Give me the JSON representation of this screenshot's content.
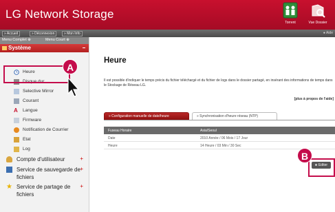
{
  "app_title": "LG Network Storage",
  "header_buttons": [
    {
      "label": "Torrent",
      "icon": "torrent-icon"
    },
    {
      "label": "Vue Dossier",
      "icon": "folder-view-icon"
    }
  ],
  "topbar": {
    "buttons": [
      "» Accueil",
      "» Déconnexion",
      "» Mon Info"
    ],
    "help": "Aide"
  },
  "sidebar": {
    "menu_complet": "Menu Complet ⊕",
    "menu_court": "Menu Court ⊕",
    "system_label": "Système",
    "items": [
      {
        "label": "Heure",
        "icon": "clock-icon"
      },
      {
        "label": "Disque dur",
        "icon": "hard-disk-icon"
      },
      {
        "label": "Selective Mirror",
        "icon": "mirror-icon"
      },
      {
        "label": "Courant",
        "icon": "power-icon"
      },
      {
        "label": "Langue",
        "icon": "language-icon"
      },
      {
        "label": "Firmware",
        "icon": "firmware-icon"
      },
      {
        "label": "Notification de Courrier",
        "icon": "mail-notification-icon"
      },
      {
        "label": "Etat",
        "icon": "status-icon"
      },
      {
        "label": "Log",
        "icon": "log-icon"
      }
    ],
    "groups": [
      {
        "label": "Compte d'utilisateur",
        "icon": "users-icon"
      },
      {
        "label": "Service de sauvegarde de fichiers",
        "icon": "backup-icon"
      },
      {
        "label": "Service de partage de fichiers",
        "icon": "share-icon"
      }
    ]
  },
  "main": {
    "title": "Heure",
    "description": "Il est possible d'indiquer le temps précis du fichier téléchargé et du fichier de logs dans le dossier partagé, en insérant des informations de temps dans le Stockage de Réseau LG.",
    "more_link": "[plus à propos de l'aide]",
    "tabs": [
      "» Configuration manuelle de date/heure",
      "» Synchronisation d'heure réseau (NTP)"
    ],
    "table": {
      "headers": [
        "Fuseau Horaire",
        "Asia/Seoul"
      ],
      "rows": [
        [
          "Date",
          "2010 Année / 06 Mois / 17 Jour"
        ],
        [
          "Heure",
          "14 Heure / 03 Min / 30 Sec"
        ]
      ]
    },
    "edit_button": "Editer"
  },
  "callouts": {
    "a": "A",
    "b": "B"
  },
  "colors": {
    "brand_red": "#c8102e",
    "callout": "#c40c4b"
  }
}
